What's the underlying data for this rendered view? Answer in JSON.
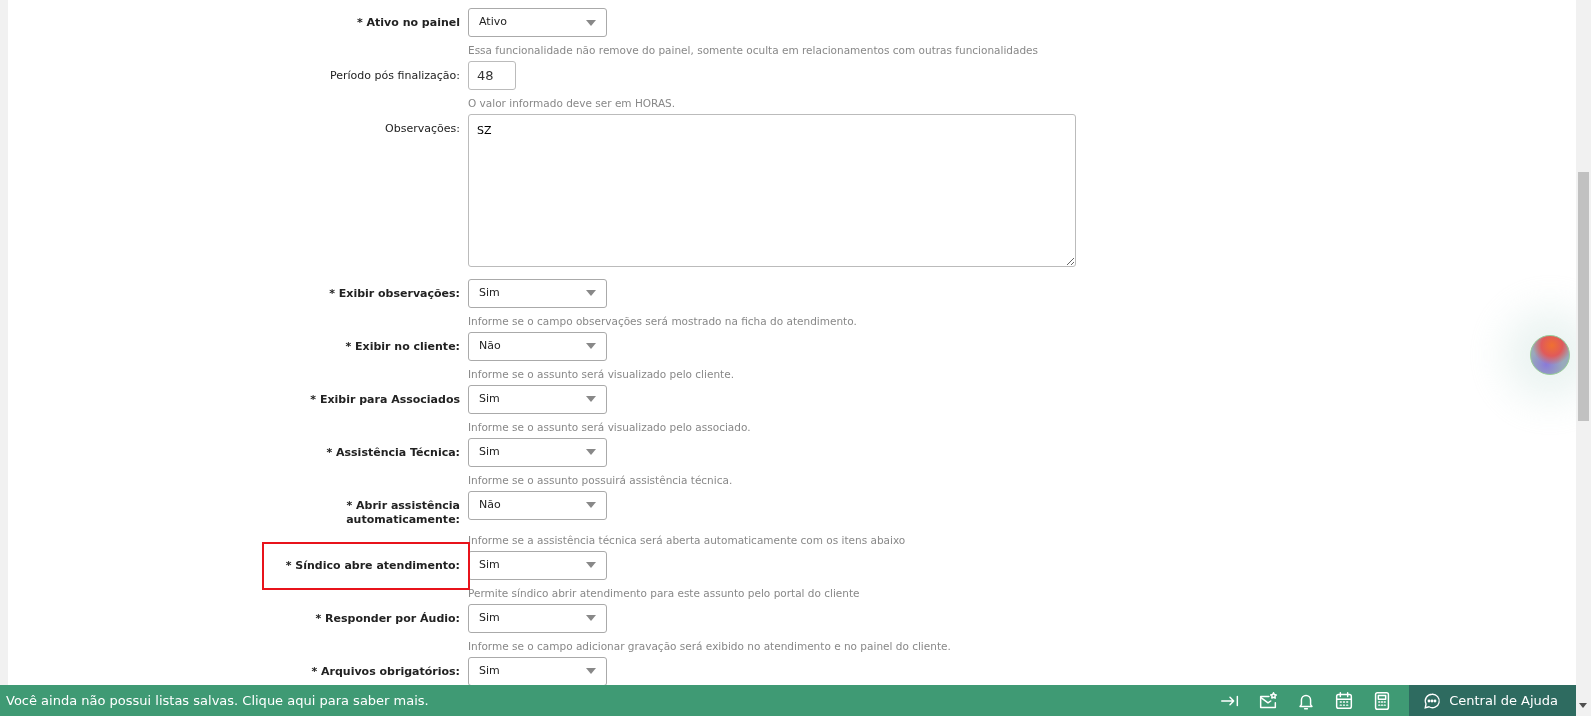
{
  "form": {
    "fields": [
      {
        "kind": "select",
        "label": "* Ativo no painel",
        "required": true,
        "highlighted": false,
        "value": "Ativo",
        "help": "Essa funcionalidade não remove do painel, somente oculta em relacionamentos com outras funcionalidades"
      },
      {
        "kind": "input",
        "label": "Período pós finalização:",
        "required": false,
        "highlighted": false,
        "value": "48",
        "help": "O valor informado deve ser em HORAS."
      },
      {
        "kind": "textarea",
        "label": "Observações:",
        "required": false,
        "highlighted": false,
        "value": "SZ"
      },
      {
        "kind": "select",
        "label": "* Exibir observações:",
        "required": true,
        "highlighted": false,
        "value": "Sim",
        "help": "Informe se o campo observações será mostrado na ficha do atendimento."
      },
      {
        "kind": "select",
        "label": "* Exibir no cliente:",
        "required": true,
        "highlighted": false,
        "value": "Não",
        "help": "Informe se o assunto será visualizado pelo cliente."
      },
      {
        "kind": "select",
        "label": "* Exibir para Associados",
        "required": true,
        "highlighted": false,
        "value": "Sim",
        "help": "Informe se o assunto será visualizado pelo associado."
      },
      {
        "kind": "select",
        "label": "* Assistência Técnica:",
        "required": true,
        "highlighted": false,
        "value": "Sim",
        "help": "Informe se o assunto possuirá assistência técnica."
      },
      {
        "kind": "select",
        "label": "* Abrir assistência automaticamente:",
        "required": true,
        "highlighted": false,
        "value": "Não",
        "help": "Informe se a assistência técnica será aberta automaticamente com os itens abaixo"
      },
      {
        "kind": "select",
        "label": "* Síndico abre atendimento:",
        "required": true,
        "highlighted": true,
        "value": "Sim",
        "help": "Permite síndico abrir atendimento para este assunto pelo portal do cliente"
      },
      {
        "kind": "select",
        "label": "* Responder por Áudio:",
        "required": true,
        "highlighted": false,
        "value": "Sim",
        "help": "Informe se o campo adicionar gravação será exibido no atendimento e no painel do cliente."
      },
      {
        "kind": "select",
        "label": "* Arquivos obrigatórios:",
        "required": true,
        "highlighted": false,
        "value": "Sim"
      }
    ]
  },
  "bottom_bar": {
    "message": "Você ainda não possui listas salvas. Clique aqui para saber mais.",
    "icons": [
      {
        "kind": "collapse"
      },
      {
        "kind": "mail"
      },
      {
        "kind": "bell"
      },
      {
        "kind": "calendar"
      },
      {
        "kind": "calculator"
      }
    ],
    "help_button": "Central de Ajuda"
  }
}
